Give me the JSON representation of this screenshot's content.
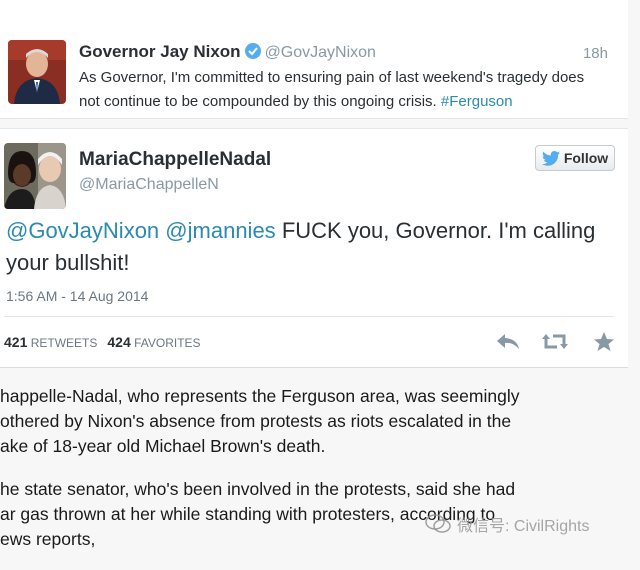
{
  "reply_tweet": {
    "name": "Governor Jay Nixon",
    "handle": "@GovJayNixon",
    "time": "18h",
    "text_main": "As Governor, I'm committed to ensuring pain of last weekend's tragedy does not continue to be compounded by this ongoing crisis.",
    "hashtag": "#Ferguson"
  },
  "main_tweet": {
    "name": "MariaChappelleNadal",
    "handle": "@MariaChappelleN",
    "follow_label": "Follow",
    "mention1": "@GovJayNixon",
    "mention2": "@jmannies",
    "text_rest": "FUCK you, Governor. I'm calling your bullshit!",
    "timestamp": "1:56 AM - 14 Aug 2014",
    "retweets_count": "421",
    "retweets_label": "RETWEETS",
    "favorites_count": "424",
    "favorites_label": "FAVORITES"
  },
  "article": {
    "para1_line1": "happelle-Nadal, who represents the Ferguson area, was seemingly",
    "para1_line2": "othered by Nixon's absence from protests as riots escalated in the",
    "para1_line3": "ake of  18-year old Michael Brown's death.",
    "para2_line1": "he state senator, who's been involved in the protests, said she had",
    "para2_line2": "ar gas thrown at her while standing with protesters, according to",
    "para2_line3": "ews reports,"
  },
  "watermark": {
    "text": "微信号: CivilRights"
  },
  "colors": {
    "link": "#2a8ab0",
    "verified": "#55acee",
    "twitter_blue": "#55acee"
  }
}
